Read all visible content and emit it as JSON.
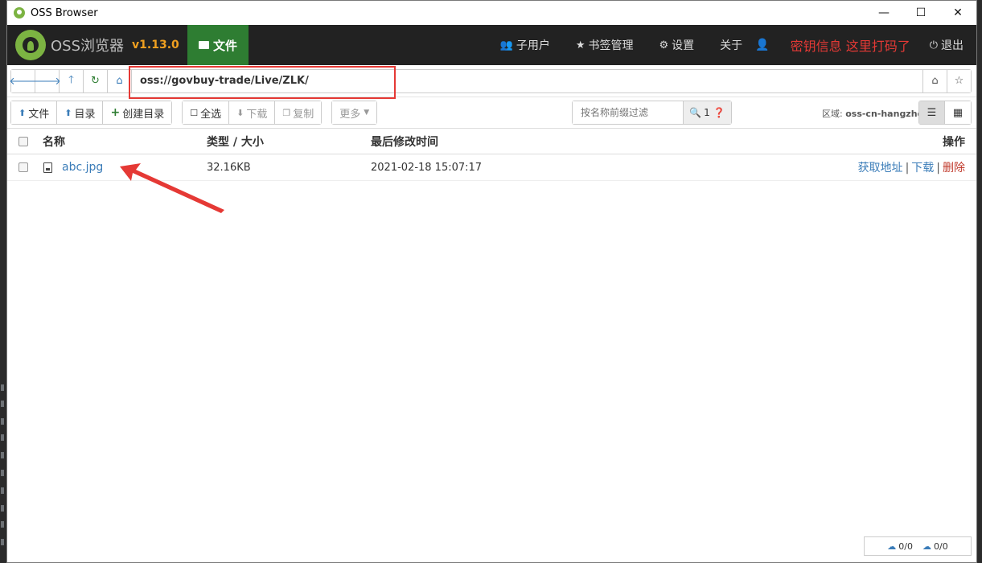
{
  "window": {
    "title": "OSS Browser",
    "controls": [
      "—",
      "☐",
      "✕"
    ]
  },
  "navbar": {
    "brand_name": "OSS浏览器",
    "version": "v1.13.0",
    "active_tab": "文件",
    "items": [
      {
        "icon": "users-icon",
        "label": "子用户"
      },
      {
        "icon": "star-icon",
        "label": "书签管理"
      },
      {
        "icon": "gear-icon",
        "label": "设置"
      },
      {
        "icon": "",
        "label": "关于"
      }
    ],
    "annotation_text": "密钥信息 这里打码了",
    "logout_label": "退出"
  },
  "address": {
    "path": "oss://govbuy-trade/Live/ZLK/"
  },
  "toolbar": {
    "upload_file": "文件",
    "upload_dir": "目录",
    "create_dir": "创建目录",
    "select_all": "全选",
    "download": "下载",
    "copy": "复制",
    "more": "更多",
    "filter_placeholder": "按名称前缀过滤",
    "filter_count": "1",
    "region_label": "区域:",
    "region_value": "oss-cn-hangzhou"
  },
  "table": {
    "headers": {
      "name": "名称",
      "type_size": "类型 / 大小",
      "modified": "最后修改时间",
      "ops": "操作"
    },
    "rows": [
      {
        "name": "abc.jpg",
        "size": "32.16KB",
        "modified": "2021-02-18 15:07:17",
        "ops": {
          "get_url": "获取地址",
          "download": "下载",
          "delete": "删除"
        }
      }
    ]
  },
  "transfers": {
    "upload": "0/0",
    "download": "0/0"
  }
}
